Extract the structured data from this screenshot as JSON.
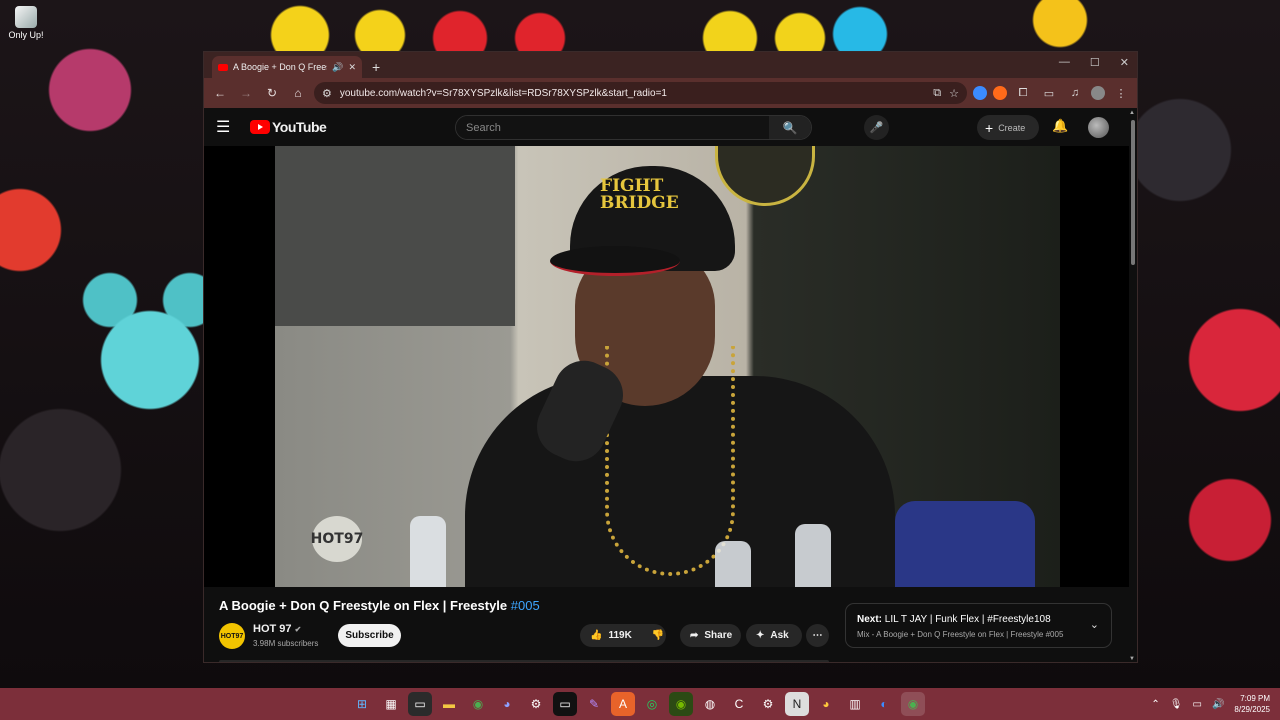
{
  "desktop": {
    "icon_label": "Only Up!"
  },
  "browser": {
    "tab_title": "A Boogie + Don Q Freestyle",
    "new_tab_icon": "plus-icon",
    "url": "youtube.com/watch?v=Sr78XYSPzlk&list=RDSr78XYSPzlk&start_radio=1",
    "window_controls": [
      "minimize-icon",
      "maximize-icon",
      "close-icon"
    ],
    "extension_colors": [
      "#3b8bff",
      "#ff6a1a"
    ]
  },
  "youtube": {
    "logo_text": "YouTube",
    "search_placeholder": "Search",
    "create_label": "Create",
    "video": {
      "title_main": "A Boogie + Don Q Freestyle on Flex | Freestyle",
      "title_tag": "#005",
      "cap_text": "FIGHT\nBRIDGE",
      "watermark": "HOT97"
    },
    "channel": {
      "name": "HOT 97",
      "avatar_text": "HOT97",
      "verified_icon": "✔",
      "subscribers": "3.98M subscribers",
      "subscribe_label": "Subscribe"
    },
    "actions": {
      "likes": "119K",
      "share_label": "Share",
      "ask_label": "Ask",
      "more_label": "⋯"
    },
    "next": {
      "prefix": "Next:",
      "title": "LIL T JAY | Funk Flex | #Freestyle108",
      "subtitle": "Mix - A Boogie + Don Q Freestyle on Flex | Freestyle #005"
    }
  },
  "taskbar": {
    "time": "7:09 PM",
    "date": "8/29/2025",
    "accent": "#7c2f3a"
  }
}
